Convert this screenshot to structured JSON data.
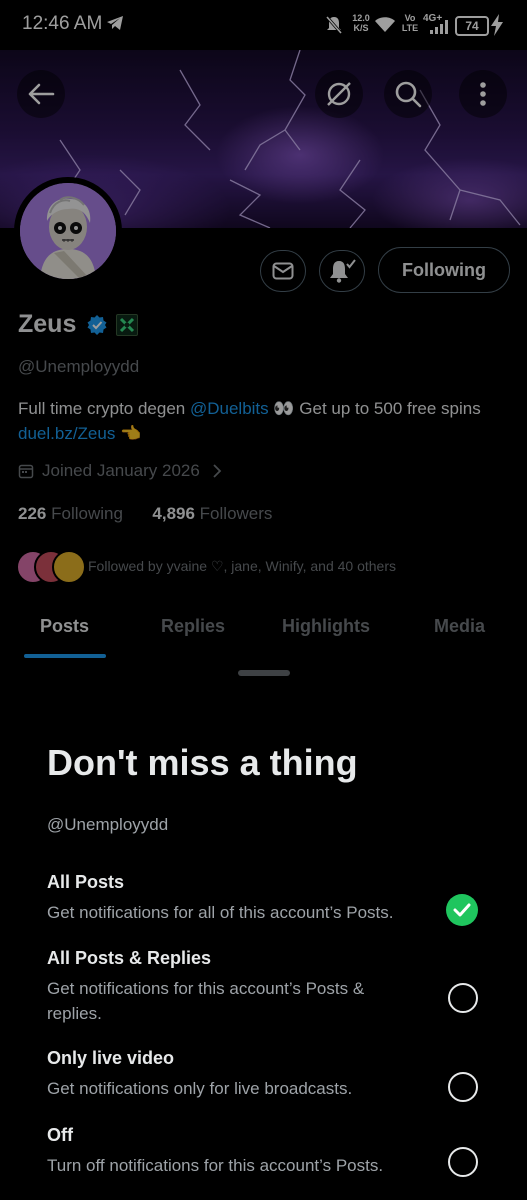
{
  "status_bar": {
    "time": "12:46 AM",
    "net_speed_top": "12.0",
    "net_speed_bottom": "K/S",
    "volte_top": "Vo",
    "volte_bottom": "LTE",
    "network": "4G+",
    "battery": "74"
  },
  "profile": {
    "name": "Zeus",
    "handle": "@Unemployydd",
    "bio_text_1": "Full time crypto degen ",
    "bio_mention": "@Duelbits",
    "bio_text_2": " 👀 Get up to 500 free spins ",
    "bio_link": "duel.bz/Zeus",
    "bio_text_3": " 👈",
    "joined": "Joined January 2026",
    "following_count": "226",
    "following_label": "Following",
    "followers_count": "4,896",
    "followers_label": "Followers",
    "followed_by": "Followed by yvaine ♡, jane, Winify, and 40 others",
    "follow_button": "Following"
  },
  "tabs": [
    {
      "label": "Posts"
    },
    {
      "label": "Replies"
    },
    {
      "label": "Highlights"
    },
    {
      "label": "Media"
    }
  ],
  "sheet": {
    "title": "Don't miss a thing",
    "handle": "@Unemployydd",
    "options": [
      {
        "title": "All Posts",
        "desc": "Get notifications for all of this account’s Posts.",
        "selected": true
      },
      {
        "title": "All Posts & Replies",
        "desc": "Get notifications for this account’s Posts & replies.",
        "selected": false
      },
      {
        "title": "Only live video",
        "desc": "Get notifications only for live broadcasts.",
        "selected": false
      },
      {
        "title": "Off",
        "desc": "Turn off notifications for this account’s Posts.",
        "selected": false
      }
    ]
  },
  "colors": {
    "accent": "#1d9bf0",
    "selected_green": "#1fc55e",
    "muted": "#71767b"
  },
  "icons": [
    "telegram-icon",
    "mute-icon",
    "wifi-icon",
    "signal-icon",
    "battery-icon",
    "charging-icon",
    "back-icon",
    "hide-reposts-icon",
    "search-icon",
    "more-icon",
    "mail-icon",
    "notification-bell-icon",
    "verified-icon",
    "affiliate-badge-icon",
    "calendar-icon",
    "chevron-right-icon",
    "check-icon"
  ]
}
